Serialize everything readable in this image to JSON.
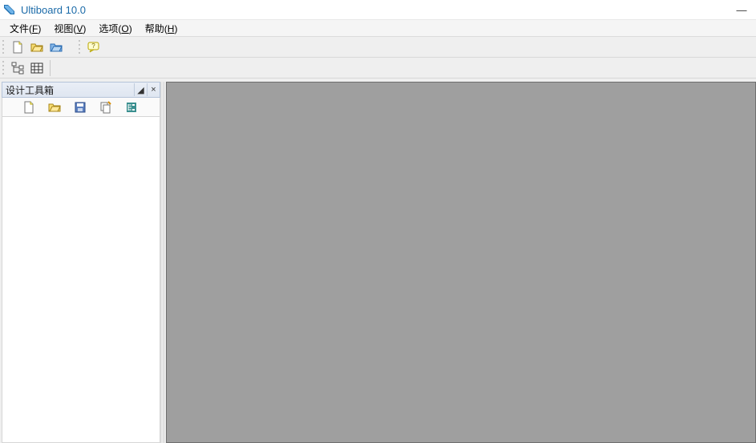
{
  "title": "Ultiboard 10.0",
  "window_controls": {
    "minimize": "—"
  },
  "menus": [
    {
      "label": "文件",
      "accel": "F"
    },
    {
      "label": "视图",
      "accel": "V"
    },
    {
      "label": "选项",
      "accel": "O"
    },
    {
      "label": "帮助",
      "accel": "H"
    }
  ],
  "toolbar1": {
    "icons": [
      "new-file-icon",
      "open-folder-icon",
      "open-example-icon"
    ],
    "icons2": [
      "help-bubble-icon"
    ]
  },
  "toolbar2": {
    "icons": [
      "tree-structure-icon",
      "grid-table-icon"
    ]
  },
  "side_panel": {
    "title": "设计工具箱",
    "header_buttons": {
      "pin": "◢",
      "close": "×"
    },
    "toolbar_icons": [
      "new-file-icon",
      "open-folder-icon",
      "save-icon",
      "copy-icon",
      "tree-tag-icon"
    ]
  }
}
